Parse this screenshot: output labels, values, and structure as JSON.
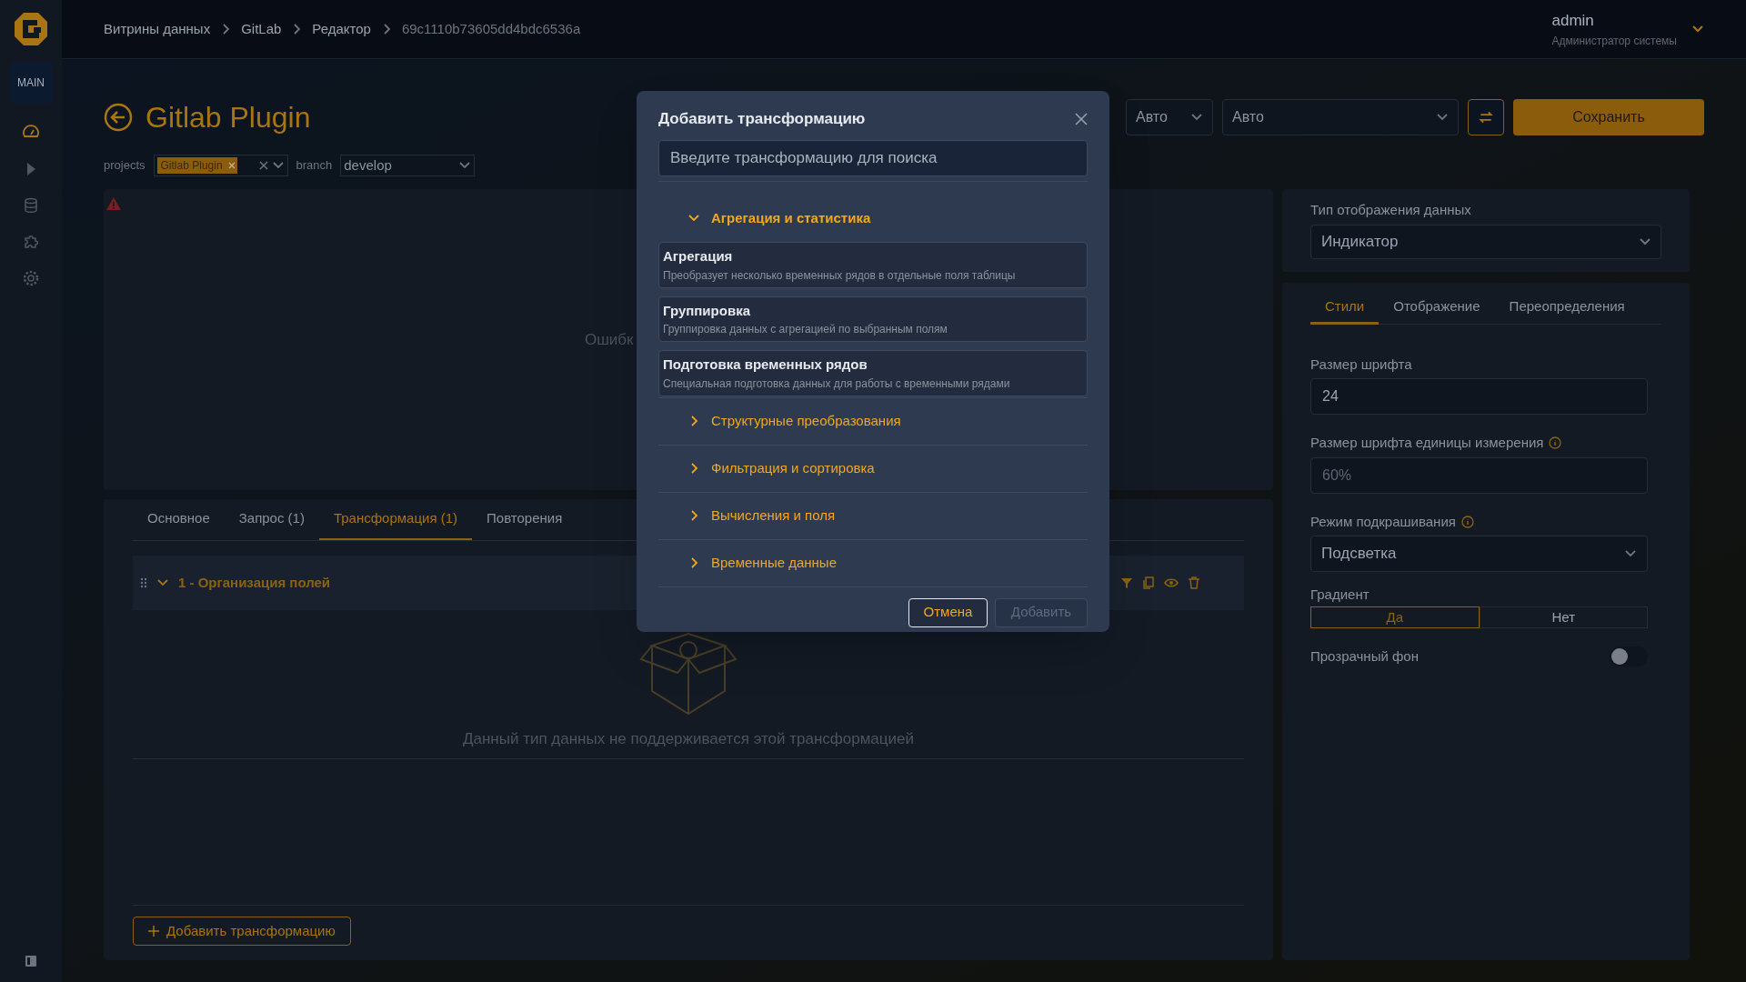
{
  "sidebar": {
    "workspace": "MAIN",
    "items": [
      {
        "selected": true
      },
      {
        "selected": false
      },
      {
        "selected": false
      },
      {
        "selected": false
      },
      {
        "selected": false
      }
    ]
  },
  "breadcrumb": [
    "Витрины данных",
    "GitLab",
    "Редактор",
    "69c1110b73605dd4bdc6536a"
  ],
  "user": {
    "name": "admin",
    "role": "Администратор системы"
  },
  "page": {
    "title": "Gitlab Plugin"
  },
  "filters": [
    {
      "kind": "tags",
      "label": "projects",
      "tags": [
        "Gitlab Plugin"
      ]
    },
    {
      "kind": "select",
      "label": "branch",
      "value": "develop"
    }
  ],
  "toolbar": {
    "selects": [
      "Авто",
      "Авто"
    ],
    "save": "Сохранить"
  },
  "preview": {
    "error_text": "Ошибк"
  },
  "editor_tabs": [
    {
      "label": "Основное",
      "selected": false
    },
    {
      "label": "Запрос (1)",
      "selected": false
    },
    {
      "label": "Трансформация (1)",
      "selected": true
    },
    {
      "label": "Повторения",
      "selected": false
    }
  ],
  "transformations": [
    {
      "title": "1 - Организация полей",
      "expanded": true
    }
  ],
  "empty_message": "Данный тип данных не поддерживается этой трансформацией",
  "add_button": "Добавить трансформацию",
  "panel": {
    "display_type_label": "Тип отображения данных",
    "display_type": "Индикатор",
    "tabs": [
      {
        "label": "Стили",
        "selected": true
      },
      {
        "label": "Отображение",
        "selected": false
      },
      {
        "label": "Переопределения",
        "selected": false
      }
    ],
    "fields": [
      {
        "kind": "input",
        "label": "Размер шрифта",
        "value": "24",
        "info": false
      },
      {
        "kind": "input",
        "label": "Размер шрифта единицы измерения",
        "placeholder": "60%",
        "info": true
      },
      {
        "kind": "select",
        "label": "Режим подкрашивания",
        "value": "Подсветка",
        "info": true
      },
      {
        "kind": "segmented",
        "label": "Градиент",
        "options": [
          {
            "label": "Да",
            "selected": true
          },
          {
            "label": "Нет",
            "selected": false
          }
        ]
      },
      {
        "kind": "toggle",
        "label": "Прозрачный фон",
        "on": false
      }
    ]
  },
  "modal": {
    "title": "Добавить трансформацию",
    "search": {
      "placeholder": "Введите трансформацию для поиска"
    },
    "groups": [
      {
        "label": "Агрегация и статистика",
        "expanded": true,
        "items": [
          {
            "title": "Агрегация",
            "description": "Преобразует несколько временных рядов в отдельные поля таблицы"
          },
          {
            "title": "Группировка",
            "description": "Группировка данных с агрегацией по выбранным полям"
          },
          {
            "title": "Подготовка временных рядов",
            "description": "Специальная подготовка данных для работы с временными рядами"
          }
        ]
      },
      {
        "label": "Структурные преобразования",
        "expanded": false
      },
      {
        "label": "Фильтрация и сортировка",
        "expanded": false
      },
      {
        "label": "Вычисления и поля",
        "expanded": false
      },
      {
        "label": "Временные данные",
        "expanded": false
      }
    ],
    "buttons": [
      {
        "label": "Отмена",
        "disabled": false
      },
      {
        "label": "Добавить",
        "disabled": true
      }
    ]
  }
}
